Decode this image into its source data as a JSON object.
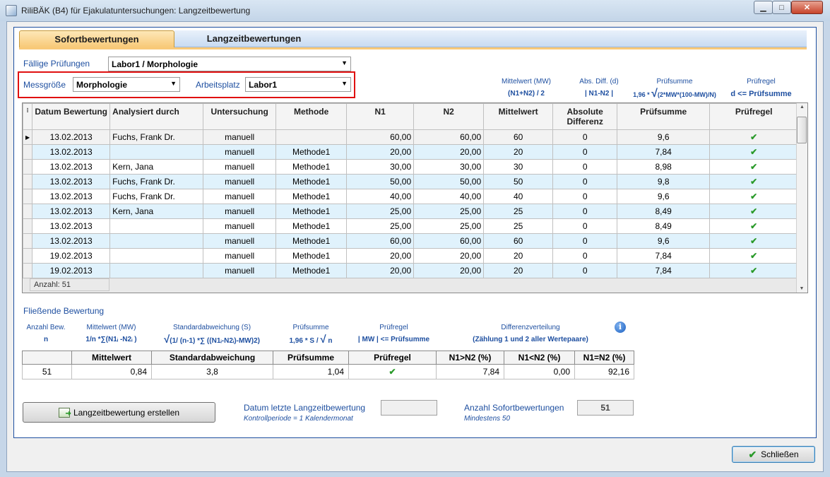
{
  "window": {
    "title": "RiliBÄK (B4) für Ejakulatuntersuchungen: Langzeitbewertung",
    "minimize": "▁",
    "maximize": "□",
    "close": "✕"
  },
  "tabs": [
    {
      "label": "Sofortbewertungen",
      "active": true
    },
    {
      "label": "Langzeitbewertungen",
      "active": false
    }
  ],
  "filters": {
    "faellige_label": "Fällige Prüfungen",
    "faellige_value": "Labor1 / Morphologie",
    "messgroesse_label": "Messgröße",
    "messgroesse_value": "Morphologie",
    "arbeitsplatz_label": "Arbeitsplatz",
    "arbeitsplatz_value": "Labor1"
  },
  "formula_hints": {
    "mw_title": "Mittelwert (MW)",
    "mw_formula": "(N1+N2) / 2",
    "diff_title": "Abs. Diff. (d)",
    "diff_formula": "| N1-N2 |",
    "pruefsumme_title": "Prüfsumme",
    "pruefsumme_prefix": "1,96 *",
    "pruefsumme_formula": "(2*MW*(100-MW)/N)",
    "pruefregel_title": "Prüfregel",
    "pruefregel_formula": "d <= Prüfsumme"
  },
  "grid": {
    "columns": [
      "Datum Bewertung",
      "Analysiert durch",
      "Untersuchung",
      "Methode",
      "N1",
      "N2",
      "Mittelwert",
      "Absolute Differenz",
      "Prüfsumme",
      "Prüfregel"
    ],
    "rows": [
      {
        "datum": "13.02.2013",
        "analysiert": "Fuchs, Frank Dr.",
        "untersuchung": "manuell",
        "methode": "",
        "n1": "60,00",
        "n2": "60,00",
        "mw": "60",
        "diff": "0",
        "summe": "9,6",
        "regel": "✔"
      },
      {
        "datum": "13.02.2013",
        "analysiert": "",
        "untersuchung": "manuell",
        "methode": "Methode1",
        "n1": "20,00",
        "n2": "20,00",
        "mw": "20",
        "diff": "0",
        "summe": "7,84",
        "regel": "✔"
      },
      {
        "datum": "13.02.2013",
        "analysiert": "Kern, Jana",
        "untersuchung": "manuell",
        "methode": "Methode1",
        "n1": "30,00",
        "n2": "30,00",
        "mw": "30",
        "diff": "0",
        "summe": "8,98",
        "regel": "✔"
      },
      {
        "datum": "13.02.2013",
        "analysiert": "Fuchs, Frank Dr.",
        "untersuchung": "manuell",
        "methode": "Methode1",
        "n1": "50,00",
        "n2": "50,00",
        "mw": "50",
        "diff": "0",
        "summe": "9,8",
        "regel": "✔"
      },
      {
        "datum": "13.02.2013",
        "analysiert": "Fuchs, Frank Dr.",
        "untersuchung": "manuell",
        "methode": "Methode1",
        "n1": "40,00",
        "n2": "40,00",
        "mw": "40",
        "diff": "0",
        "summe": "9,6",
        "regel": "✔"
      },
      {
        "datum": "13.02.2013",
        "analysiert": "Kern, Jana",
        "untersuchung": "manuell",
        "methode": "Methode1",
        "n1": "25,00",
        "n2": "25,00",
        "mw": "25",
        "diff": "0",
        "summe": "8,49",
        "regel": "✔"
      },
      {
        "datum": "13.02.2013",
        "analysiert": "",
        "untersuchung": "manuell",
        "methode": "Methode1",
        "n1": "25,00",
        "n2": "25,00",
        "mw": "25",
        "diff": "0",
        "summe": "8,49",
        "regel": "✔"
      },
      {
        "datum": "13.02.2013",
        "analysiert": "",
        "untersuchung": "manuell",
        "methode": "Methode1",
        "n1": "60,00",
        "n2": "60,00",
        "mw": "60",
        "diff": "0",
        "summe": "9,6",
        "regel": "✔"
      },
      {
        "datum": "19.02.2013",
        "analysiert": "",
        "untersuchung": "manuell",
        "methode": "Methode1",
        "n1": "20,00",
        "n2": "20,00",
        "mw": "20",
        "diff": "0",
        "summe": "7,84",
        "regel": "✔"
      },
      {
        "datum": "19.02.2013",
        "analysiert": "",
        "untersuchung": "manuell",
        "methode": "Methode1",
        "n1": "20,00",
        "n2": "20,00",
        "mw": "20",
        "diff": "0",
        "summe": "7,84",
        "regel": "✔"
      }
    ],
    "footer": "Anzahl: 51"
  },
  "fliessend": {
    "title": "Fließende Bewertung",
    "anzahl_title": "Anzahl Bew.",
    "anzahl_formula": "n",
    "mw_title": "Mittelwert (MW)",
    "mw_formula": "1/n *∑(N1ᵢ -N2ᵢ )",
    "sd_title": "Standardabweichung (S)",
    "sd_formula": "(1/ (n-1) *∑ ((N1ᵢ-N2ᵢ)-MW)2)",
    "ps_title": "Prüfsumme",
    "ps_prefix": "1,96 * S /",
    "ps_suffix": "n",
    "pr_title": "Prüfregel",
    "pr_formula": "| MW |  <= Prüfsumme",
    "dv_title": "Differenzverteilung",
    "dv_formula": "(Zählung 1 und 2 aller Wertepaare)",
    "info_icon": "i",
    "columns": [
      "",
      "Mittelwert",
      "Standardabweichung",
      "Prüfsumme",
      "Prüfregel",
      "N1>N2 (%)",
      "N1<N2 (%)",
      "N1=N2 (%)"
    ],
    "row": {
      "n": "51",
      "mw": "0,84",
      "sd": "3,8",
      "ps": "1,04",
      "pr": "✔",
      "gt": "7,84",
      "lt": "0,00",
      "eq": "92,16"
    }
  },
  "bottom": {
    "create_button": "Langzeitbewertung erstellen",
    "datum_label": "Datum letzte Langzeitbewertung",
    "datum_sub": "Kontrollperiode = 1 Kalendermonat",
    "datum_value": "",
    "anzahl_label": "Anzahl Sofortbewertungen",
    "anzahl_sub": "Mindestens 50",
    "anzahl_value": "51",
    "close_button": "Schließen"
  }
}
